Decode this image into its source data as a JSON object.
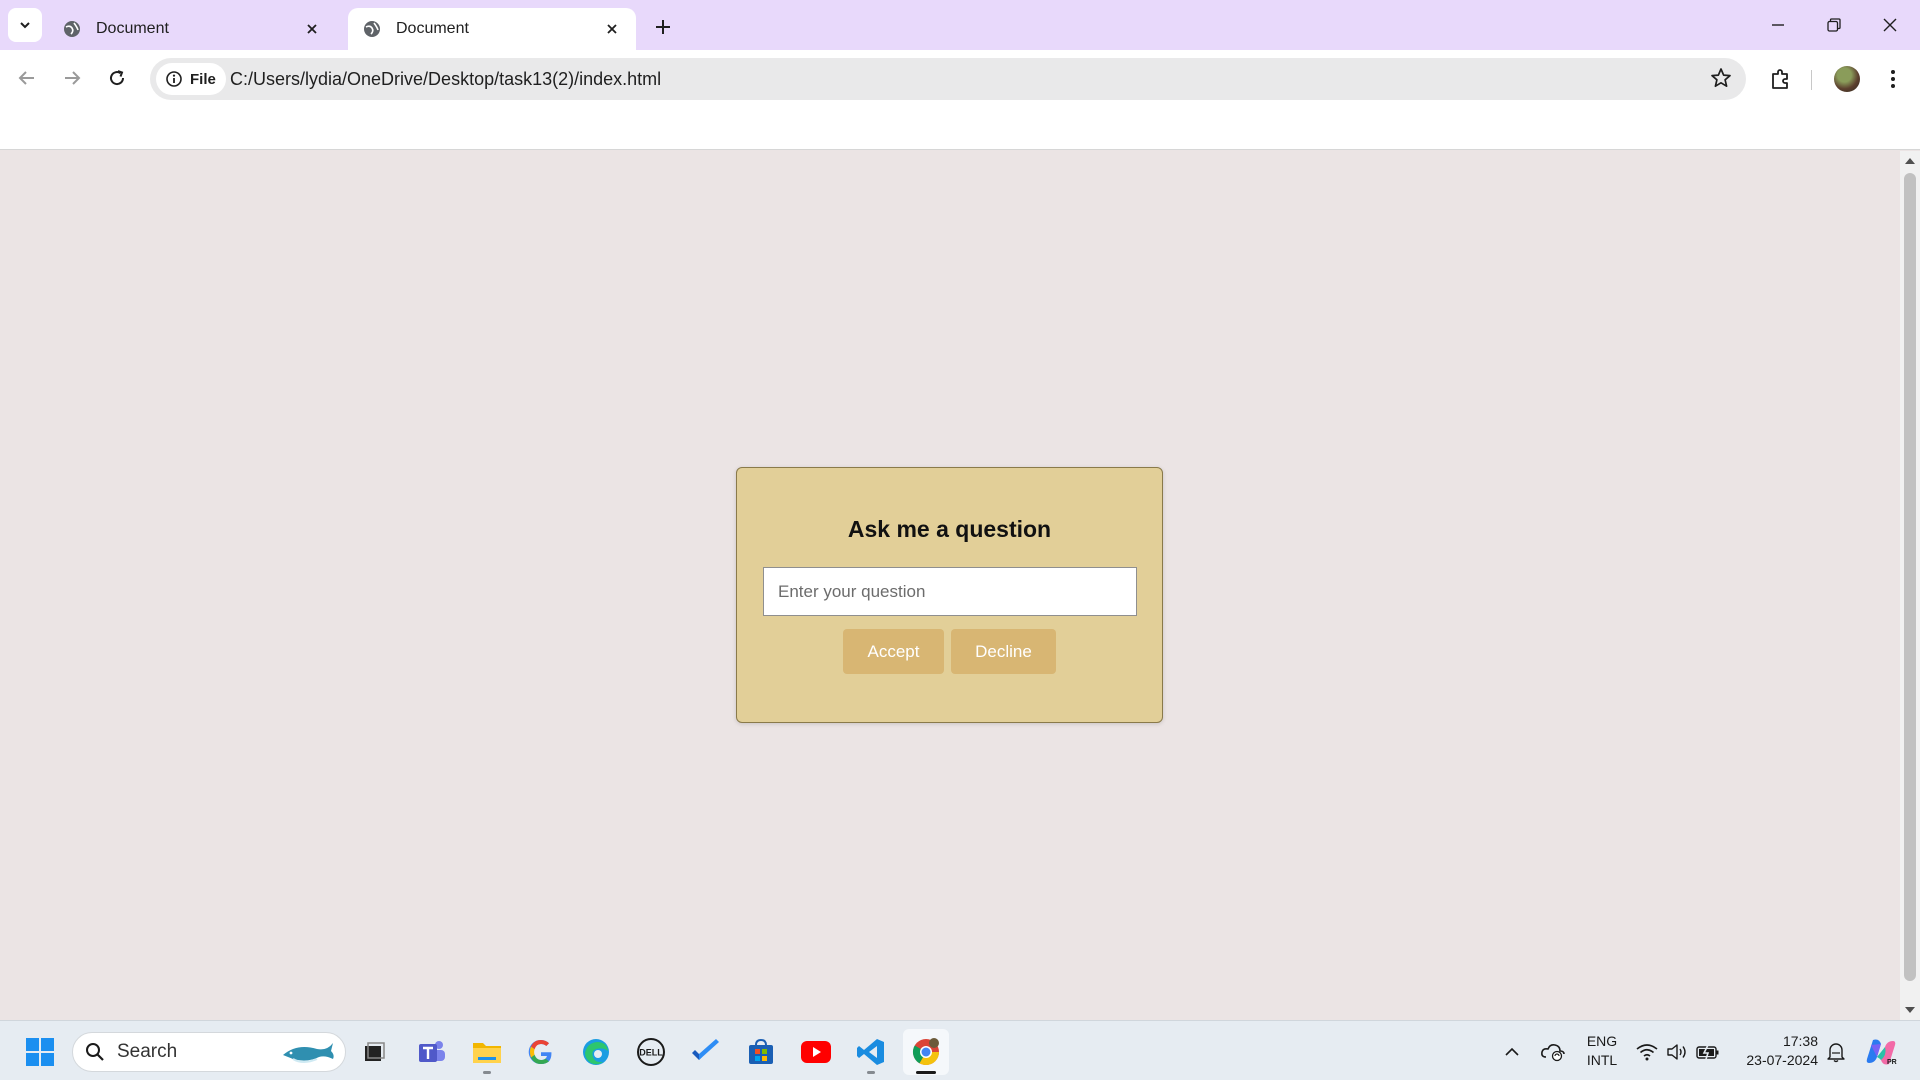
{
  "browser": {
    "tabs": [
      {
        "title": "Document",
        "active": false
      },
      {
        "title": "Document",
        "active": true
      }
    ],
    "address": {
      "scheme_label": "File",
      "url": "C:/Users/lydia/OneDrive/Desktop/task13(2)/index.html"
    }
  },
  "page": {
    "heading": "Ask me a question",
    "input_placeholder": "Enter your question",
    "input_value": "",
    "accept_label": "Accept",
    "decline_label": "Decline",
    "colors": {
      "background": "#ebe4e4",
      "card": "#e2cf98",
      "button": "#d8b673"
    }
  },
  "taskbar": {
    "search_label": "Search",
    "apps": [
      "start-icon",
      "task-view-icon",
      "teams-icon",
      "file-explorer-icon",
      "google-icon",
      "edge-icon",
      "dell-icon",
      "todo-icon",
      "store-icon",
      "youtube-icon",
      "vscode-icon",
      "chrome-icon"
    ],
    "tray": {
      "lang_top": "ENG",
      "lang_bottom": "INTL",
      "time": "17:38",
      "date": "23-07-2024"
    }
  }
}
